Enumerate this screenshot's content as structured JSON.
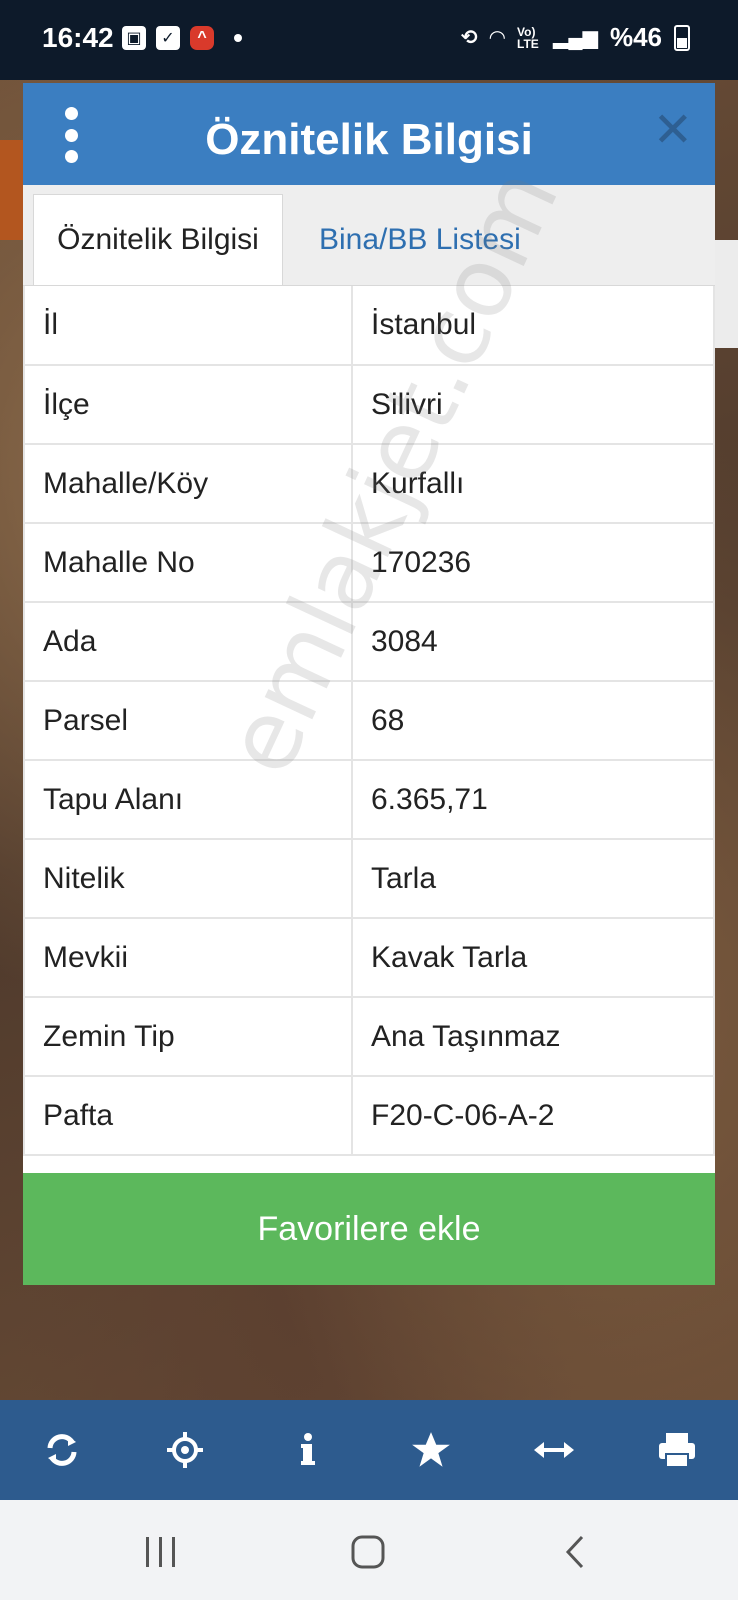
{
  "status_bar": {
    "time": "16:42",
    "battery_text": "%46",
    "network_label": "Vo) LTE"
  },
  "modal": {
    "title": "Öznitelik Bilgisi",
    "tabs": [
      {
        "label": "Öznitelik Bilgisi",
        "active": true
      },
      {
        "label": "Bina/BB Listesi",
        "active": false
      }
    ],
    "rows": [
      {
        "key": "İl",
        "value": "İstanbul"
      },
      {
        "key": "İlçe",
        "value": "Silivri"
      },
      {
        "key": "Mahalle/Köy",
        "value": "Kurfallı"
      },
      {
        "key": "Mahalle No",
        "value": "170236"
      },
      {
        "key": "Ada",
        "value": "3084"
      },
      {
        "key": "Parsel",
        "value": "68"
      },
      {
        "key": "Tapu Alanı",
        "value": "6.365,71"
      },
      {
        "key": "Nitelik",
        "value": "Tarla"
      },
      {
        "key": "Mevkii",
        "value": "Kavak Tarla"
      },
      {
        "key": "Zemin Tip",
        "value": "Ana Taşınmaz"
      },
      {
        "key": "Pafta",
        "value": "F20-C-06-A-2"
      }
    ],
    "favorite_button": "Favorilere ekle"
  },
  "watermark": "emlakjet.com",
  "toolbar": {
    "icons": [
      "refresh-icon",
      "locate-icon",
      "info-icon",
      "star-icon",
      "measure-icon",
      "print-icon"
    ]
  },
  "colors": {
    "header": "#3b7ec1",
    "toolbar": "#2d5b8e",
    "favorite": "#5cb85c"
  }
}
